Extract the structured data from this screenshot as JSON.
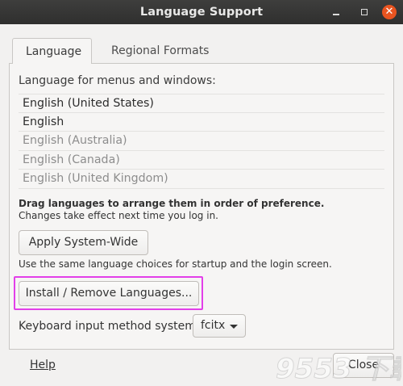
{
  "window": {
    "title": "Language Support",
    "controls": {
      "minimize_icon": "minimize-icon",
      "maximize_icon": "maximize-icon",
      "close_icon": "close-icon",
      "close_glyph": "✕"
    }
  },
  "tabs": [
    {
      "label": "Language",
      "active": true
    },
    {
      "label": "Regional Formats",
      "active": false
    }
  ],
  "language": {
    "menus_label": "Language for menus and windows:",
    "list": [
      {
        "label": "English (United States)",
        "enabled": true
      },
      {
        "label": "English",
        "enabled": true
      },
      {
        "label": "English (Australia)",
        "enabled": false
      },
      {
        "label": "English (Canada)",
        "enabled": false
      },
      {
        "label": "English (United Kingdom)",
        "enabled": false
      }
    ],
    "drag_hint": "Drag languages to arrange them in order of preference.",
    "login_hint": "Changes take effect next time you log in.",
    "apply_button": "Apply System-Wide",
    "startup_hint": "Use the same language choices for startup and the login screen.",
    "install_button": "Install / Remove Languages...",
    "keyboard_label": "Keyboard input method system:",
    "keyboard_value": "fcitx"
  },
  "footer": {
    "help_link": "Help",
    "close_button": "Close",
    "watermark_text": "9553 下载"
  },
  "colors": {
    "titlebar": "#3e3e3d",
    "close_accent": "#e95420",
    "highlight": "#e23fe9"
  }
}
